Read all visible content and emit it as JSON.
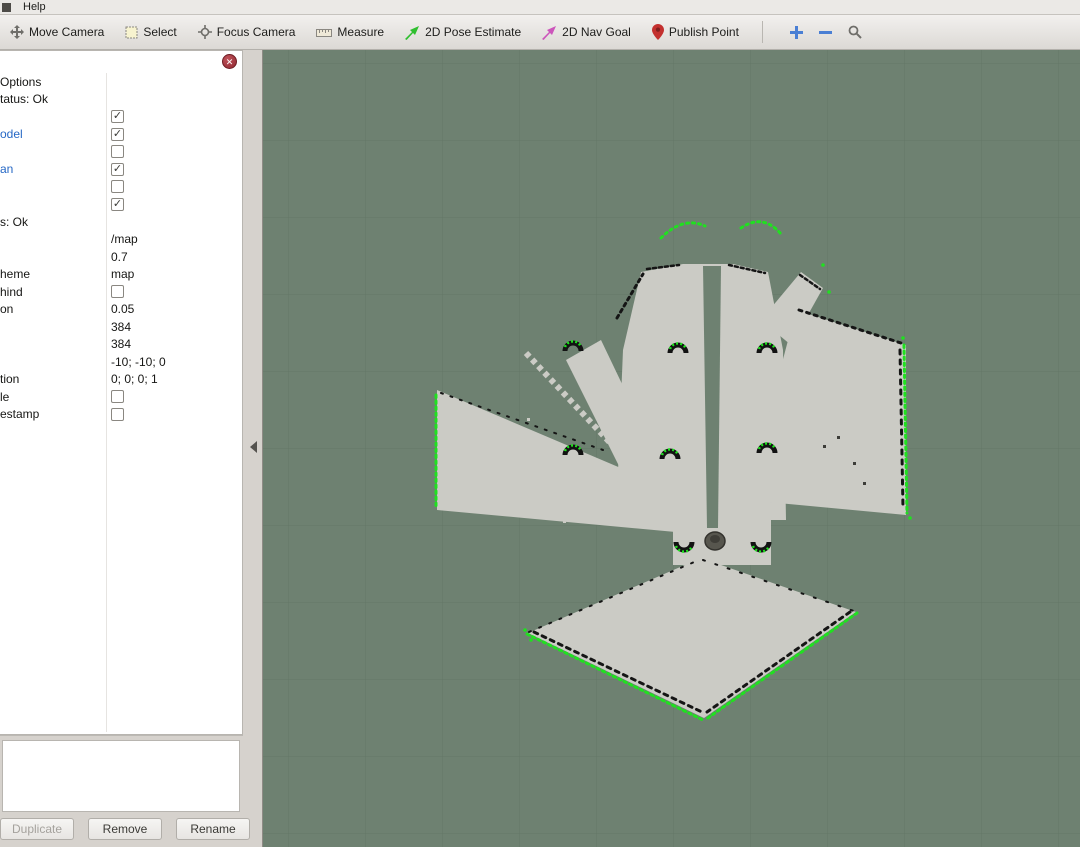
{
  "menubar": {
    "items": [
      {
        "label": "Help"
      }
    ]
  },
  "toolbar": {
    "tools": [
      {
        "label": "Move Camera",
        "icon": "move-camera-icon"
      },
      {
        "label": "Select",
        "icon": "select-icon"
      },
      {
        "label": "Focus Camera",
        "icon": "focus-camera-icon"
      },
      {
        "label": "Measure",
        "icon": "measure-icon"
      },
      {
        "label": "2D Pose Estimate",
        "icon": "pose-estimate-icon"
      },
      {
        "label": "2D Nav Goal",
        "icon": "nav-goal-icon"
      },
      {
        "label": "Publish Point",
        "icon": "publish-point-icon"
      }
    ],
    "zoom_tools": [
      {
        "icon": "zoom-in-icon"
      },
      {
        "icon": "zoom-out-icon"
      },
      {
        "icon": "magnifier-icon"
      }
    ]
  },
  "icons": {
    "close": "✕",
    "check": "✓"
  },
  "displays_panel": {
    "rows": [
      {
        "left": "Options"
      },
      {
        "left": "tatus: Ok"
      },
      {
        "type": "checkbox",
        "checked": true
      },
      {
        "left": "odel",
        "style": "link",
        "type": "checkbox",
        "checked": true
      },
      {
        "type": "checkbox",
        "checked": false
      },
      {
        "left": "an",
        "style": "link",
        "type": "checkbox",
        "checked": true
      },
      {
        "type": "checkbox",
        "checked": false
      },
      {
        "type": "checkbox",
        "checked": true
      },
      {
        "left": "s: Ok"
      },
      {
        "value": "/map"
      },
      {
        "value": "0.7"
      },
      {
        "left": "heme",
        "value": "map"
      },
      {
        "left": "hind",
        "type": "checkbox",
        "checked": false
      },
      {
        "left": "on",
        "value": "0.05"
      },
      {
        "value": "384"
      },
      {
        "value": "384"
      },
      {
        "value": "-10; -10; 0"
      },
      {
        "left": "tion",
        "value": "0; 0; 0; 1"
      },
      {
        "left": "le",
        "type": "checkbox",
        "checked": false
      },
      {
        "left": "estamp",
        "type": "checkbox",
        "checked": false
      }
    ],
    "buttons": [
      {
        "label": "Duplicate",
        "enabled": false
      },
      {
        "label": "Remove",
        "enabled": true
      },
      {
        "label": "Rename",
        "enabled": true
      }
    ]
  },
  "viewport": {
    "colors": {
      "background": "#6e8171",
      "grid": "#5a6d5c",
      "map_free": "#cbcbc5",
      "map_obstacle": "#151515",
      "laser_scan": "#20e020",
      "robot": "#57564e"
    }
  }
}
